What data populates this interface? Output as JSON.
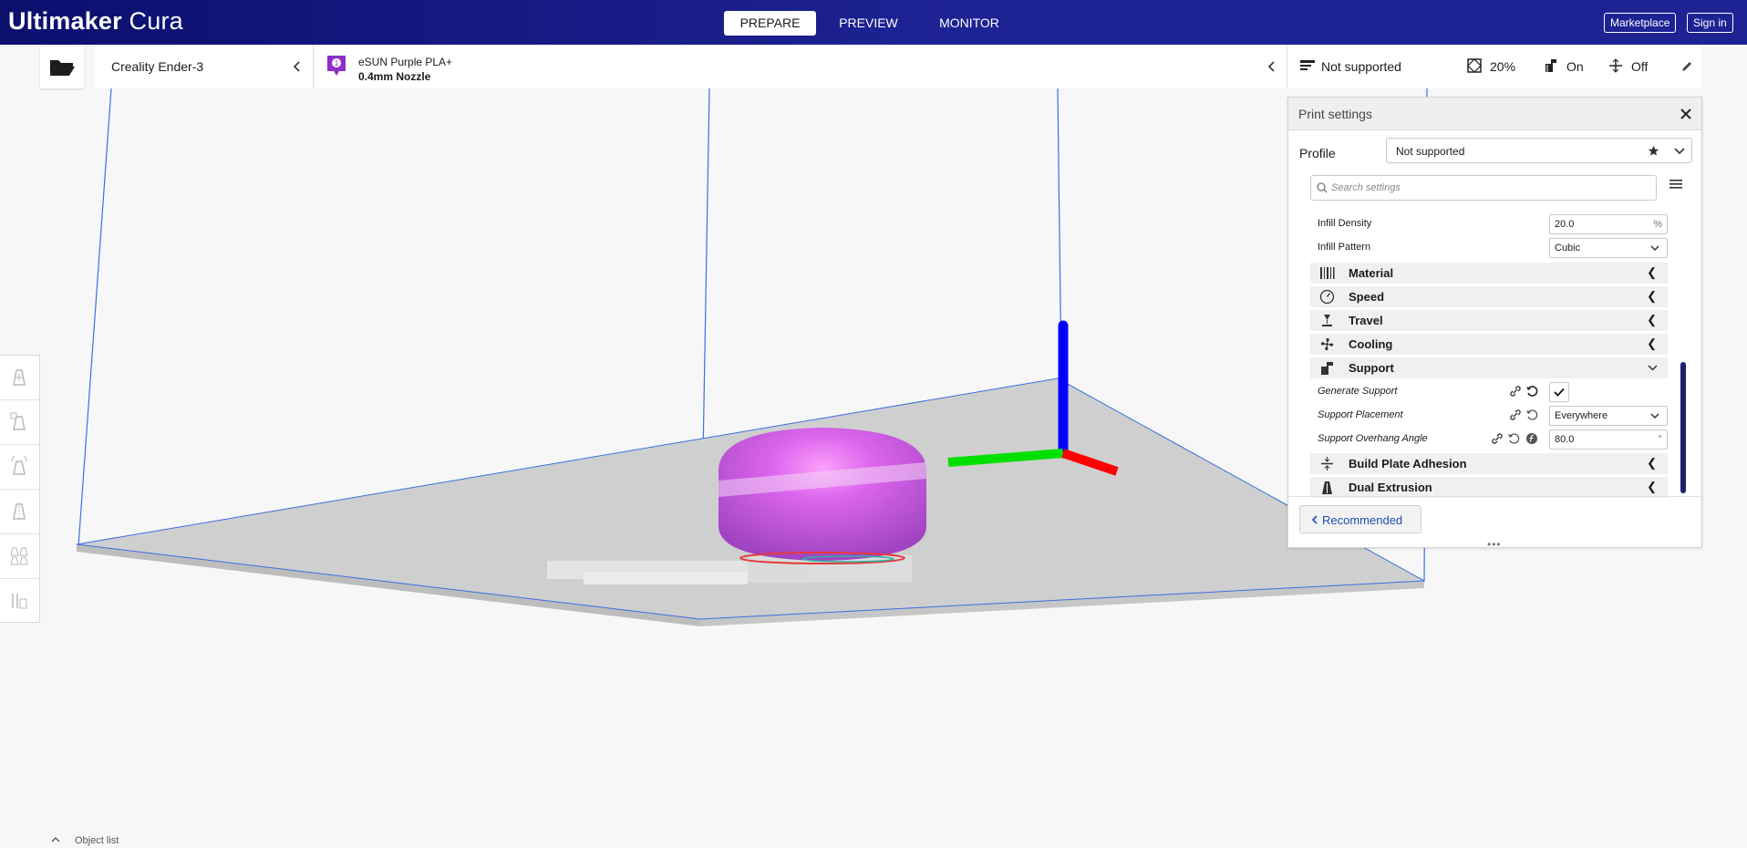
{
  "app": {
    "title_bold": "Ultimaker",
    "title_rest": " Cura"
  },
  "stages": [
    {
      "label": "PREPARE",
      "active": true
    },
    {
      "label": "PREVIEW",
      "active": false
    },
    {
      "label": "MONITOR",
      "active": false
    }
  ],
  "header_buttons": {
    "marketplace": "Marketplace",
    "signin": "Sign in"
  },
  "printer": {
    "name": "Creality Ender-3"
  },
  "material": {
    "name": "eSUN Purple PLA+",
    "nozzle": "0.4mm Nozzle",
    "badge": "1",
    "color": "#8e2fc8"
  },
  "print_setup": {
    "profile": "Not supported",
    "infill": "20%",
    "support": "On",
    "adhesion": "Off"
  },
  "print_settings": {
    "title": "Print settings",
    "profile_label": "Profile",
    "profile_value": "Not supported",
    "search_placeholder": "Search settings",
    "recommended_label": "Recommended",
    "rows": [
      {
        "label": "Infill Density",
        "value": "20.0",
        "unit": "%"
      },
      {
        "label": "Infill Pattern",
        "value": "Cubic"
      }
    ],
    "categories": [
      "Material",
      "Speed",
      "Travel",
      "Cooling",
      "Support",
      "Build Plate Adhesion",
      "Dual Extrusion"
    ],
    "support_rows": [
      {
        "label": "Generate Support",
        "checked": true
      },
      {
        "label": "Support Placement",
        "value": "Everywhere"
      },
      {
        "label": "Support Overhang Angle",
        "value": "80.0",
        "unit": "°"
      }
    ]
  },
  "object_list": {
    "label": "Object list"
  },
  "colors": {
    "header": "#1e2394",
    "accent_blue": "#1f4fb0",
    "axis_x": "#ff0000",
    "axis_y": "#00e000",
    "axis_z": "#0000ff",
    "model": "#c24fe6"
  },
  "icons": [
    "open-folder-icon",
    "chevron-left-icon",
    "support-icon",
    "infill-icon",
    "adhesion-icon",
    "edit-icon",
    "close-icon",
    "star-icon",
    "chevron-down-icon",
    "search-icon",
    "menu-icon",
    "link-icon",
    "reset-icon",
    "function-icon",
    "check-icon"
  ]
}
